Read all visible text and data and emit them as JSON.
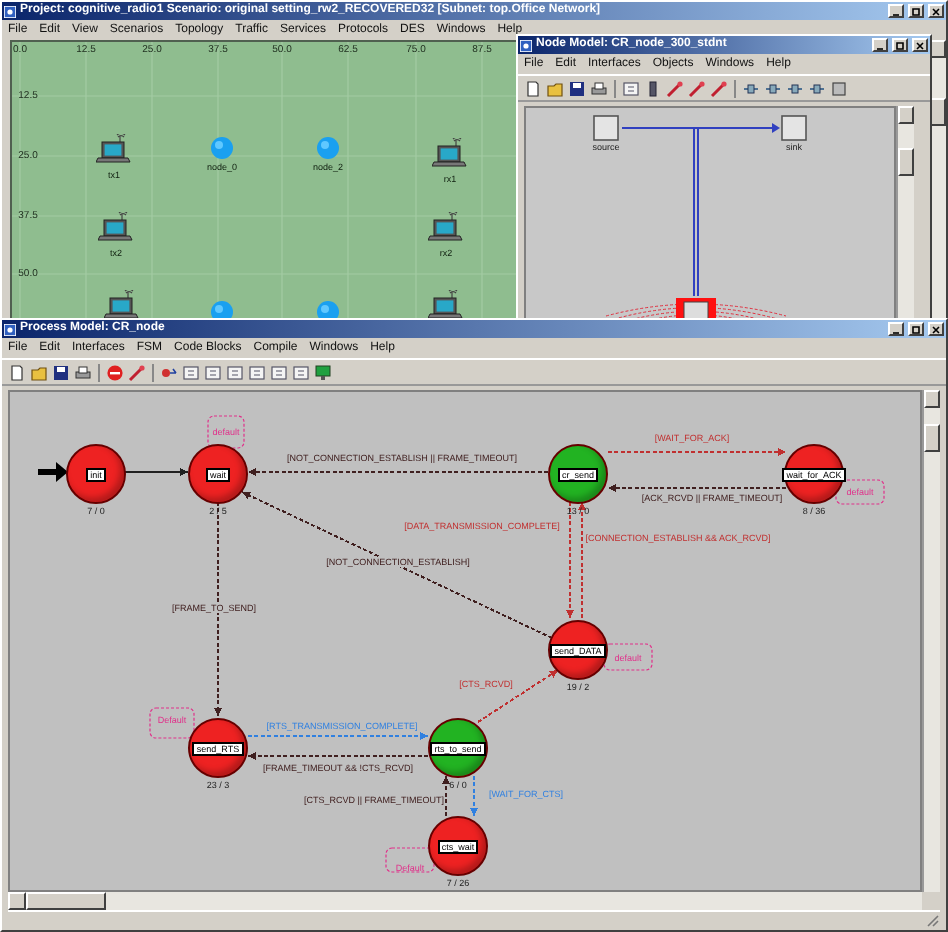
{
  "project_window": {
    "title": "Project: cognitive_radio1 Scenario: original setting_rw2_RECOVERED32 [Subnet: top.Office Network]",
    "menu": [
      "File",
      "Edit",
      "View",
      "Scenarios",
      "Topology",
      "Traffic",
      "Services",
      "Protocols",
      "DES",
      "Windows",
      "Help"
    ],
    "x_ruler": [
      "0.0",
      "12.5",
      "25.0",
      "37.5",
      "50.0",
      "62.5",
      "75.0",
      "87.5"
    ],
    "y_ruler": [
      "12.5",
      "25.0",
      "37.5",
      "50.0"
    ],
    "nodes": [
      {
        "kind": "laptop",
        "label": "tx1"
      },
      {
        "kind": "station",
        "label": "node_0"
      },
      {
        "kind": "station",
        "label": "node_2"
      },
      {
        "kind": "laptop",
        "label": "rx1"
      },
      {
        "kind": "laptop",
        "label": "tx2"
      },
      {
        "kind": "laptop",
        "label": "rx2"
      },
      {
        "kind": "laptop"
      },
      {
        "kind": "station"
      },
      {
        "kind": "station"
      },
      {
        "kind": "laptop"
      }
    ]
  },
  "node_model_window": {
    "title": "Node Model: CR_node_300_stdnt",
    "menu": [
      "File",
      "Edit",
      "Interfaces",
      "Objects",
      "Windows",
      "Help"
    ],
    "modules": [
      {
        "label": "source"
      },
      {
        "label": "sink"
      }
    ]
  },
  "process_model_window": {
    "title": "Process Model: CR_node",
    "menu": [
      "File",
      "Edit",
      "Interfaces",
      "FSM",
      "Code Blocks",
      "Compile",
      "Windows",
      "Help"
    ],
    "states": [
      {
        "name": "init",
        "counts": "7 / 0",
        "color": "#ee2222"
      },
      {
        "name": "wait",
        "counts": "2 / 5",
        "color": "#ee2222"
      },
      {
        "name": "cr_send",
        "counts": "13 / 0",
        "color": "#22b322"
      },
      {
        "name": "wait_for_ACK",
        "counts": "8 / 36",
        "color": "#ee2222"
      },
      {
        "name": "send_DATA",
        "counts": "19 / 2",
        "color": "#ee2222"
      },
      {
        "name": "send_RTS",
        "counts": "23 / 3",
        "color": "#ee2222"
      },
      {
        "name": "rts_to_send",
        "counts": "6 / 0",
        "color": "#22b322"
      },
      {
        "name": "cts_wait",
        "counts": "7 / 26",
        "color": "#ee2222"
      }
    ],
    "transitions": [
      {
        "color": "#202020"
      },
      {
        "label": "[NOT_CONNECTION_ESTABLISH || FRAME_TIMEOUT]",
        "color": "#402020"
      },
      {
        "label": "[WAIT_FOR_ACK]",
        "color": "#c03030"
      },
      {
        "label": "[ACK_RCVD || FRAME_TIMEOUT]",
        "color": "#402020"
      },
      {
        "label": "[DATA_TRANSMISSION_COMPLETE]",
        "color": "#c03030"
      },
      {
        "label": "[CONNECTION_ESTABLISH && ACK_RCVD]",
        "color": "#c03030"
      },
      {
        "label": "[NOT_CONNECTION_ESTABLISH]",
        "color": "#402020"
      },
      {
        "label": "[FRAME_TO_SEND]",
        "color": "#402020"
      },
      {
        "label": "[CTS_RCVD]",
        "color": "#c03030"
      },
      {
        "label": "[RTS_TRANSMISSION_COMPLETE]",
        "color": "#3080e0"
      },
      {
        "label": "[FRAME_TIMEOUT && !CTS_RCVD]",
        "color": "#402020"
      },
      {
        "label": "[CTS_RCVD || FRAME_TIMEOUT]",
        "color": "#402020"
      },
      {
        "label": "[WAIT_FOR_CTS]",
        "color": "#3080e0"
      }
    ],
    "self_loops": [
      {
        "label": "default"
      },
      {
        "label": "default"
      },
      {
        "label": "default"
      },
      {
        "label": "Default"
      },
      {
        "label": "Default"
      }
    ]
  }
}
